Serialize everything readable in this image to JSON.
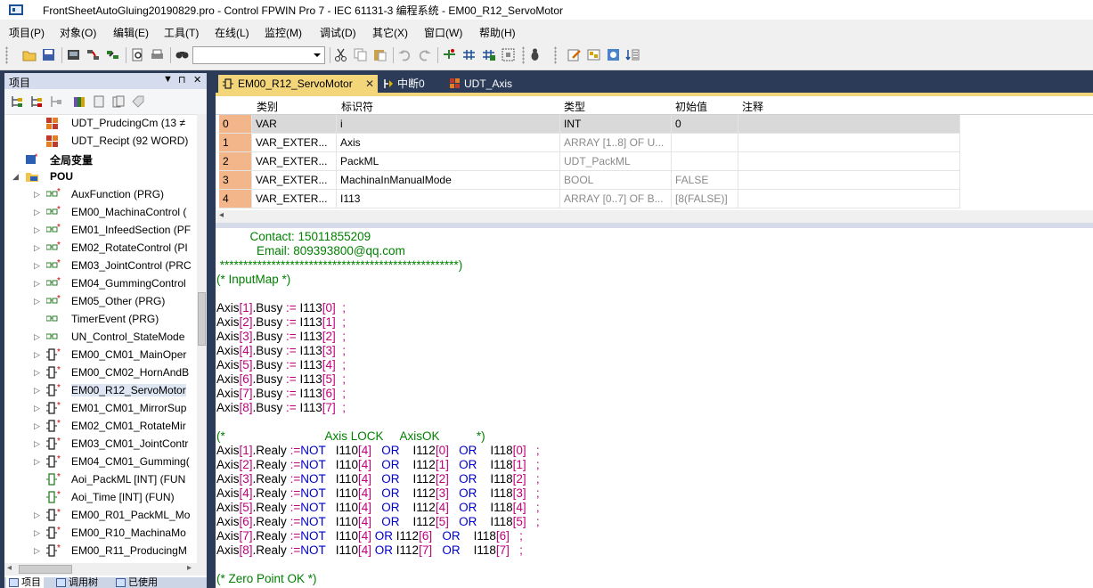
{
  "window": {
    "title": "FrontSheetAutoGluing20190829.pro - Control FPWIN Pro 7 - IEC 61131-3 编程系统 - EM00_R12_ServoMotor"
  },
  "menu": {
    "items": [
      {
        "label": "项目(P)"
      },
      {
        "label": "对象(O)"
      },
      {
        "label": "编辑(E)"
      },
      {
        "label": "工具(T)"
      },
      {
        "label": "在线(L)"
      },
      {
        "label": "监控(M)"
      },
      {
        "label": "调试(D)"
      },
      {
        "label": "其它(X)"
      },
      {
        "label": "窗口(W)"
      },
      {
        "label": "帮助(H)"
      }
    ]
  },
  "toolbar": {
    "icons": [
      "open-folder-icon",
      "save-icon",
      "compile-icon",
      "build-icon",
      "online-icon",
      "print-preview-icon",
      "print-icon",
      "find-icon",
      "cut-icon",
      "copy-icon",
      "paste-icon",
      "undo-icon",
      "redo-icon",
      "network-icon",
      "network-add-icon",
      "network-add2-icon",
      "grid-icon",
      "debug-icon",
      "edit-icon",
      "transfer-icon",
      "download-icon",
      "monitor-icon"
    ],
    "combo_value": ""
  },
  "project_panel": {
    "title": "项目",
    "controls": [
      "▼",
      "⊓",
      "✕"
    ],
    "tree": [
      {
        "label": "UDT_PrudcingCm (13 ≠",
        "indent": 1,
        "expander": "",
        "icon": "udt"
      },
      {
        "label": "UDT_Recipt (92 WORD)",
        "indent": 1,
        "expander": "",
        "icon": "udt"
      },
      {
        "label": "全局变量",
        "indent": 0,
        "expander": "",
        "icon": "global",
        "bold": true
      },
      {
        "label": "POU",
        "indent": 0,
        "expander": "◢",
        "icon": "pou",
        "bold": true
      },
      {
        "label": "AuxFunction (PRG)",
        "indent": 1,
        "expander": "▷",
        "icon": "prg"
      },
      {
        "label": "EM00_MachinaControl (",
        "indent": 1,
        "expander": "▷",
        "icon": "prg"
      },
      {
        "label": "EM01_InfeedSection (PF",
        "indent": 1,
        "expander": "▷",
        "icon": "prg"
      },
      {
        "label": "EM02_RotateControl (PI",
        "indent": 1,
        "expander": "▷",
        "icon": "prg"
      },
      {
        "label": "EM03_JointControl (PRC",
        "indent": 1,
        "expander": "▷",
        "icon": "prg"
      },
      {
        "label": "EM04_GummingControl",
        "indent": 1,
        "expander": "▷",
        "icon": "prg"
      },
      {
        "label": "EM05_Other (PRG)",
        "indent": 1,
        "expander": "▷",
        "icon": "prg"
      },
      {
        "label": "TimerEvent (PRG)",
        "indent": 1,
        "expander": "",
        "icon": "prg-plain"
      },
      {
        "label": "UN_Control_StateMode",
        "indent": 1,
        "expander": "▷",
        "icon": "prg-plain"
      },
      {
        "label": "EM00_CM01_MainOper",
        "indent": 1,
        "expander": "▷",
        "icon": "fb"
      },
      {
        "label": "EM00_CM02_HornAndB",
        "indent": 1,
        "expander": "▷",
        "icon": "fb"
      },
      {
        "label": "EM00_R12_ServoMotor",
        "indent": 1,
        "expander": "▷",
        "icon": "fb",
        "selected": true
      },
      {
        "label": "EM01_CM01_MirrorSup",
        "indent": 1,
        "expander": "▷",
        "icon": "fb"
      },
      {
        "label": "EM02_CM01_RotateMir",
        "indent": 1,
        "expander": "▷",
        "icon": "fb"
      },
      {
        "label": "EM03_CM01_JointContr",
        "indent": 1,
        "expander": "▷",
        "icon": "fb"
      },
      {
        "label": "EM04_CM01_Gumming(",
        "indent": 1,
        "expander": "▷",
        "icon": "fb"
      },
      {
        "label": "Aoi_PackML [INT] (FUN",
        "indent": 1,
        "expander": "",
        "icon": "fun"
      },
      {
        "label": "Aoi_Time [INT] (FUN)",
        "indent": 1,
        "expander": "",
        "icon": "fun"
      },
      {
        "label": "EM00_R01_PackML_Mo",
        "indent": 1,
        "expander": "▷",
        "icon": "fb"
      },
      {
        "label": "EM00_R10_MachinaMo",
        "indent": 1,
        "expander": "▷",
        "icon": "fb"
      },
      {
        "label": "EM00_R11_ProducingM",
        "indent": 1,
        "expander": "▷",
        "icon": "fb"
      }
    ],
    "bottom_tabs": [
      {
        "label": "项目",
        "active": true
      },
      {
        "label": "调用树"
      },
      {
        "label": "已使用"
      }
    ]
  },
  "doc_tabs": [
    {
      "label": "EM00_R12_ServoMotor",
      "active": true,
      "close": "✕"
    },
    {
      "label": "中断0"
    },
    {
      "label": "UDT_Axis"
    }
  ],
  "var_table": {
    "headers": [
      "类别",
      "标识符",
      "类型",
      "初始值",
      "注释"
    ],
    "rows": [
      {
        "n": "0",
        "cls": "VAR",
        "id": "i",
        "type": "INT",
        "init": "0",
        "comment": "",
        "gray": false
      },
      {
        "n": "1",
        "cls": "VAR_EXTER...",
        "id": "Axis",
        "type": "ARRAY [1..8] OF U...",
        "init": "",
        "comment": "",
        "gray": true
      },
      {
        "n": "2",
        "cls": "VAR_EXTER...",
        "id": "PackML",
        "type": "UDT_PackML",
        "init": "",
        "comment": "",
        "gray": true
      },
      {
        "n": "3",
        "cls": "VAR_EXTER...",
        "id": "MachinaInManualMode",
        "type": "BOOL",
        "init": "FALSE",
        "comment": "",
        "gray": true
      },
      {
        "n": "4",
        "cls": "VAR_EXTER...",
        "id": "I113",
        "type": "ARRAY [0..7] OF B...",
        "init": "[8(FALSE)]",
        "comment": "",
        "gray": true
      }
    ]
  },
  "code": {
    "lines": [
      {
        "segs": [
          {
            "t": "          Contact: 15011855209",
            "c": "g"
          }
        ]
      },
      {
        "segs": [
          {
            "t": "            Email: 809393800@qq.com",
            "c": "g"
          }
        ]
      },
      {
        "segs": [
          {
            "t": " ***************************************************)",
            "c": "g"
          }
        ]
      },
      {
        "segs": [
          {
            "t": "(* InputMap *)",
            "c": "g"
          }
        ]
      },
      {
        "segs": []
      },
      {
        "segs": [
          {
            "t": "Axis",
            "c": "k"
          },
          {
            "t": "[1]",
            "c": "m"
          },
          {
            "t": ".Busy ",
            "c": "k"
          },
          {
            "t": ":=",
            "c": "m"
          },
          {
            "t": " I113",
            "c": "k"
          },
          {
            "t": "[0]",
            "c": "m"
          },
          {
            "t": "  ;",
            "c": "m"
          }
        ]
      },
      {
        "segs": [
          {
            "t": "Axis",
            "c": "k"
          },
          {
            "t": "[2]",
            "c": "m"
          },
          {
            "t": ".Busy ",
            "c": "k"
          },
          {
            "t": ":=",
            "c": "m"
          },
          {
            "t": " I113",
            "c": "k"
          },
          {
            "t": "[1]",
            "c": "m"
          },
          {
            "t": "  ;",
            "c": "m"
          }
        ]
      },
      {
        "segs": [
          {
            "t": "Axis",
            "c": "k"
          },
          {
            "t": "[3]",
            "c": "m"
          },
          {
            "t": ".Busy ",
            "c": "k"
          },
          {
            "t": ":=",
            "c": "m"
          },
          {
            "t": " I113",
            "c": "k"
          },
          {
            "t": "[2]",
            "c": "m"
          },
          {
            "t": "  ;",
            "c": "m"
          }
        ]
      },
      {
        "segs": [
          {
            "t": "Axis",
            "c": "k"
          },
          {
            "t": "[4]",
            "c": "m"
          },
          {
            "t": ".Busy ",
            "c": "k"
          },
          {
            "t": ":=",
            "c": "m"
          },
          {
            "t": " I113",
            "c": "k"
          },
          {
            "t": "[3]",
            "c": "m"
          },
          {
            "t": "  ;",
            "c": "m"
          }
        ]
      },
      {
        "segs": [
          {
            "t": "Axis",
            "c": "k"
          },
          {
            "t": "[5]",
            "c": "m"
          },
          {
            "t": ".Busy ",
            "c": "k"
          },
          {
            "t": ":=",
            "c": "m"
          },
          {
            "t": " I113",
            "c": "k"
          },
          {
            "t": "[4]",
            "c": "m"
          },
          {
            "t": "  ;",
            "c": "m"
          }
        ]
      },
      {
        "segs": [
          {
            "t": "Axis",
            "c": "k"
          },
          {
            "t": "[6]",
            "c": "m"
          },
          {
            "t": ".Busy ",
            "c": "k"
          },
          {
            "t": ":=",
            "c": "m"
          },
          {
            "t": " I113",
            "c": "k"
          },
          {
            "t": "[5]",
            "c": "m"
          },
          {
            "t": "  ;",
            "c": "m"
          }
        ]
      },
      {
        "segs": [
          {
            "t": "Axis",
            "c": "k"
          },
          {
            "t": "[7]",
            "c": "m"
          },
          {
            "t": ".Busy ",
            "c": "k"
          },
          {
            "t": ":=",
            "c": "m"
          },
          {
            "t": " I113",
            "c": "k"
          },
          {
            "t": "[6]",
            "c": "m"
          },
          {
            "t": "  ;",
            "c": "m"
          }
        ]
      },
      {
        "segs": [
          {
            "t": "Axis",
            "c": "k"
          },
          {
            "t": "[8]",
            "c": "m"
          },
          {
            "t": ".Busy ",
            "c": "k"
          },
          {
            "t": ":=",
            "c": "m"
          },
          {
            "t": " I113",
            "c": "k"
          },
          {
            "t": "[7]",
            "c": "m"
          },
          {
            "t": "  ;",
            "c": "m"
          }
        ]
      },
      {
        "segs": []
      },
      {
        "segs": [
          {
            "t": "(*                              Axis LOCK     AxisOK           *)",
            "c": "g"
          }
        ]
      },
      {
        "segs": [
          {
            "t": "Axis",
            "c": "k"
          },
          {
            "t": "[1]",
            "c": "m"
          },
          {
            "t": ".Realy ",
            "c": "k"
          },
          {
            "t": ":=",
            "c": "m"
          },
          {
            "t": "NOT",
            "c": "b"
          },
          {
            "t": "   I110",
            "c": "k"
          },
          {
            "t": "[4]",
            "c": "m"
          },
          {
            "t": "   OR",
            "c": "b"
          },
          {
            "t": "    I112",
            "c": "k"
          },
          {
            "t": "[0]",
            "c": "m"
          },
          {
            "t": "   OR",
            "c": "b"
          },
          {
            "t": "    I118",
            "c": "k"
          },
          {
            "t": "[0]",
            "c": "m"
          },
          {
            "t": "   ;",
            "c": "m"
          }
        ]
      },
      {
        "segs": [
          {
            "t": "Axis",
            "c": "k"
          },
          {
            "t": "[2]",
            "c": "m"
          },
          {
            "t": ".Realy ",
            "c": "k"
          },
          {
            "t": ":=",
            "c": "m"
          },
          {
            "t": "NOT",
            "c": "b"
          },
          {
            "t": "   I110",
            "c": "k"
          },
          {
            "t": "[4]",
            "c": "m"
          },
          {
            "t": "   OR",
            "c": "b"
          },
          {
            "t": "    I112",
            "c": "k"
          },
          {
            "t": "[1]",
            "c": "m"
          },
          {
            "t": "   OR",
            "c": "b"
          },
          {
            "t": "    I118",
            "c": "k"
          },
          {
            "t": "[1]",
            "c": "m"
          },
          {
            "t": "   ;",
            "c": "m"
          }
        ]
      },
      {
        "segs": [
          {
            "t": "Axis",
            "c": "k"
          },
          {
            "t": "[3]",
            "c": "m"
          },
          {
            "t": ".Realy ",
            "c": "k"
          },
          {
            "t": ":=",
            "c": "m"
          },
          {
            "t": "NOT",
            "c": "b"
          },
          {
            "t": "   I110",
            "c": "k"
          },
          {
            "t": "[4]",
            "c": "m"
          },
          {
            "t": "   OR",
            "c": "b"
          },
          {
            "t": "    I112",
            "c": "k"
          },
          {
            "t": "[2]",
            "c": "m"
          },
          {
            "t": "   OR",
            "c": "b"
          },
          {
            "t": "    I118",
            "c": "k"
          },
          {
            "t": "[2]",
            "c": "m"
          },
          {
            "t": "   ;",
            "c": "m"
          }
        ]
      },
      {
        "segs": [
          {
            "t": "Axis",
            "c": "k"
          },
          {
            "t": "[4]",
            "c": "m"
          },
          {
            "t": ".Realy ",
            "c": "k"
          },
          {
            "t": ":=",
            "c": "m"
          },
          {
            "t": "NOT",
            "c": "b"
          },
          {
            "t": "   I110",
            "c": "k"
          },
          {
            "t": "[4]",
            "c": "m"
          },
          {
            "t": "   OR",
            "c": "b"
          },
          {
            "t": "    I112",
            "c": "k"
          },
          {
            "t": "[3]",
            "c": "m"
          },
          {
            "t": "   OR",
            "c": "b"
          },
          {
            "t": "    I118",
            "c": "k"
          },
          {
            "t": "[3]",
            "c": "m"
          },
          {
            "t": "   ;",
            "c": "m"
          }
        ]
      },
      {
        "segs": [
          {
            "t": "Axis",
            "c": "k"
          },
          {
            "t": "[5]",
            "c": "m"
          },
          {
            "t": ".Realy ",
            "c": "k"
          },
          {
            "t": ":=",
            "c": "m"
          },
          {
            "t": "NOT",
            "c": "b"
          },
          {
            "t": "   I110",
            "c": "k"
          },
          {
            "t": "[4]",
            "c": "m"
          },
          {
            "t": "   OR",
            "c": "b"
          },
          {
            "t": "    I112",
            "c": "k"
          },
          {
            "t": "[4]",
            "c": "m"
          },
          {
            "t": "   OR",
            "c": "b"
          },
          {
            "t": "    I118",
            "c": "k"
          },
          {
            "t": "[4]",
            "c": "m"
          },
          {
            "t": "   ;",
            "c": "m"
          }
        ]
      },
      {
        "segs": [
          {
            "t": "Axis",
            "c": "k"
          },
          {
            "t": "[6]",
            "c": "m"
          },
          {
            "t": ".Realy ",
            "c": "k"
          },
          {
            "t": ":=",
            "c": "m"
          },
          {
            "t": "NOT",
            "c": "b"
          },
          {
            "t": "   I110",
            "c": "k"
          },
          {
            "t": "[4]",
            "c": "m"
          },
          {
            "t": "   OR",
            "c": "b"
          },
          {
            "t": "    I112",
            "c": "k"
          },
          {
            "t": "[5]",
            "c": "m"
          },
          {
            "t": "   OR",
            "c": "b"
          },
          {
            "t": "    I118",
            "c": "k"
          },
          {
            "t": "[5]",
            "c": "m"
          },
          {
            "t": "   ;",
            "c": "m"
          }
        ]
      },
      {
        "segs": [
          {
            "t": "Axis",
            "c": "k"
          },
          {
            "t": "[7]",
            "c": "m"
          },
          {
            "t": ".Realy ",
            "c": "k"
          },
          {
            "t": ":=",
            "c": "m"
          },
          {
            "t": "NOT",
            "c": "b"
          },
          {
            "t": "   I110",
            "c": "k"
          },
          {
            "t": "[4]",
            "c": "m"
          },
          {
            "t": " OR",
            "c": "b"
          },
          {
            "t": " I112",
            "c": "k"
          },
          {
            "t": "[6]",
            "c": "m"
          },
          {
            "t": "   OR",
            "c": "b"
          },
          {
            "t": "    I118",
            "c": "k"
          },
          {
            "t": "[6]",
            "c": "m"
          },
          {
            "t": "   ;",
            "c": "m"
          }
        ]
      },
      {
        "segs": [
          {
            "t": "Axis",
            "c": "k"
          },
          {
            "t": "[8]",
            "c": "m"
          },
          {
            "t": ".Realy ",
            "c": "k"
          },
          {
            "t": ":=",
            "c": "m"
          },
          {
            "t": "NOT",
            "c": "b"
          },
          {
            "t": "   I110",
            "c": "k"
          },
          {
            "t": "[4]",
            "c": "m"
          },
          {
            "t": " OR",
            "c": "b"
          },
          {
            "t": " I112",
            "c": "k"
          },
          {
            "t": "[7]",
            "c": "m"
          },
          {
            "t": "   OR",
            "c": "b"
          },
          {
            "t": "    I118",
            "c": "k"
          },
          {
            "t": "[7]",
            "c": "m"
          },
          {
            "t": "   ;",
            "c": "m"
          }
        ]
      },
      {
        "segs": []
      },
      {
        "segs": [
          {
            "t": "(* Zero Point OK *)",
            "c": "g"
          }
        ]
      }
    ]
  },
  "colors": {
    "accent_tab": "#f4d67a",
    "row_number_bg": "#f3b68a",
    "selected_row_bg": "#d9d9d9",
    "comment_green": "#008000",
    "keyword_blue": "#0000c8",
    "operator_magenta": "#c0007a"
  }
}
